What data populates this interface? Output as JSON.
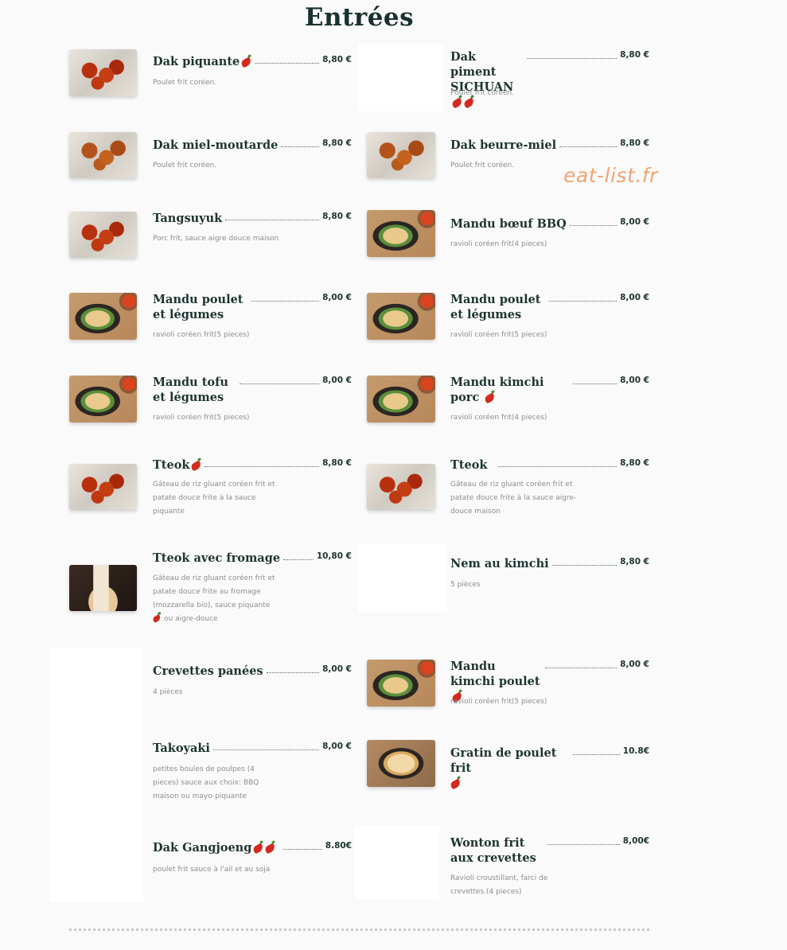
{
  "title": "Entrées",
  "watermark": "eat-list.fr",
  "items": [
    {
      "name": "Dak piquante",
      "chilies": 1,
      "price": "8,80 €",
      "desc": "Poulet frit coréen.",
      "image": "fried-chicken-spicy"
    },
    {
      "name": "Dak piment SICHUAN",
      "chilies": 2,
      "price": "8,80 €",
      "desc": "Poulet frit coréen.",
      "image": "none"
    },
    {
      "name": "Dak miel-moutarde",
      "chilies": 0,
      "price": "8,80 €",
      "desc": "Poulet frit coréen.",
      "image": "fried-chicken"
    },
    {
      "name": "Dak beurre-miel",
      "chilies": 0,
      "price": "8,80 €",
      "desc": "Poulet frit coréen.",
      "image": "fried-chicken"
    },
    {
      "name": "Tangsuyuk",
      "chilies": 0,
      "price": "8,80 €",
      "desc": "Porc frit, sauce aigre douce maison",
      "image": "fried-chicken-red"
    },
    {
      "name": "Mandu bœuf BBQ",
      "chilies": 0,
      "price": "8,00 €",
      "desc": "ravioli coréen frit(4 pieces)",
      "image": "mandu"
    },
    {
      "name": "Mandu poulet et légumes",
      "chilies": 0,
      "price": "8,00 €",
      "desc": "ravioli coréen frit(5 pieces)",
      "image": "mandu"
    },
    {
      "name": "Mandu poulet et légumes",
      "chilies": 0,
      "price": "8,00 €",
      "desc": "ravioli coréen frit(5 pieces)",
      "image": "mandu"
    },
    {
      "name": "Mandu tofu et légumes",
      "chilies": 0,
      "price": "8,00 €",
      "desc": "ravioli coréen frit(5 pieces)",
      "image": "mandu"
    },
    {
      "name": "Mandu kimchi porc",
      "chilies": 1,
      "price": "8,00 €",
      "desc": "ravioli coréen frit(4 pieces)",
      "image": "mandu"
    },
    {
      "name": "Tteok",
      "chilies": 1,
      "price": "8,80 €",
      "desc": "Gâteau de riz gluant coréen frit et patate douce frite à la sauce piquante",
      "image": "fried-chicken-red"
    },
    {
      "name": "Tteok",
      "chilies": 0,
      "price": "8,80 €",
      "desc": "Gâteau de riz gluant coréen frit et patate douce frite à la sauce aigre-douce maison",
      "image": "fried-chicken-red"
    },
    {
      "name": "Tteok avec fromage",
      "chilies": 0,
      "price": "10,80 €",
      "desc": "Gâteau de riz gluant coréen frit et patate douce frite au fromage (mozzarella bio), sauce piquante",
      "desc_tail": "ou aigre-douce",
      "image": "gratin"
    },
    {
      "name": "Nem au kimchi",
      "chilies": 0,
      "price": "8,80 €",
      "desc": "5 pièces",
      "image": "none"
    },
    {
      "name": "Crevettes panées",
      "chilies": 0,
      "price": "8,00 €",
      "desc": "4 pièces",
      "image": "none"
    },
    {
      "name": "Mandu kimchi poulet",
      "chilies": 1,
      "price": "8,00 €",
      "desc": "ravioli coréen frit(5 pieces)",
      "image": "mandu"
    },
    {
      "name": "Takoyaki",
      "chilies": 0,
      "price": "8,00 €",
      "desc": "petites boules de poulpes (4 pieces) sauce aux choix: BBQ maison ou mayo-piquante",
      "image": "none"
    },
    {
      "name": "Gratin de poulet frit",
      "chilies": 1,
      "price": "10.8€",
      "desc": "",
      "image": "cheese-pull"
    },
    {
      "name": "Dak Gangjoeng",
      "chilies": 2,
      "price": "8.80€",
      "desc": "poulet frit sauce à l'ail et au soja",
      "image": "none"
    },
    {
      "name": "Wonton frit aux crevettes",
      "chilies": 0,
      "price": "8,00€",
      "desc": "Ravioli croustillant, farci de crevettes.(4 pieces)",
      "image": "none"
    }
  ]
}
